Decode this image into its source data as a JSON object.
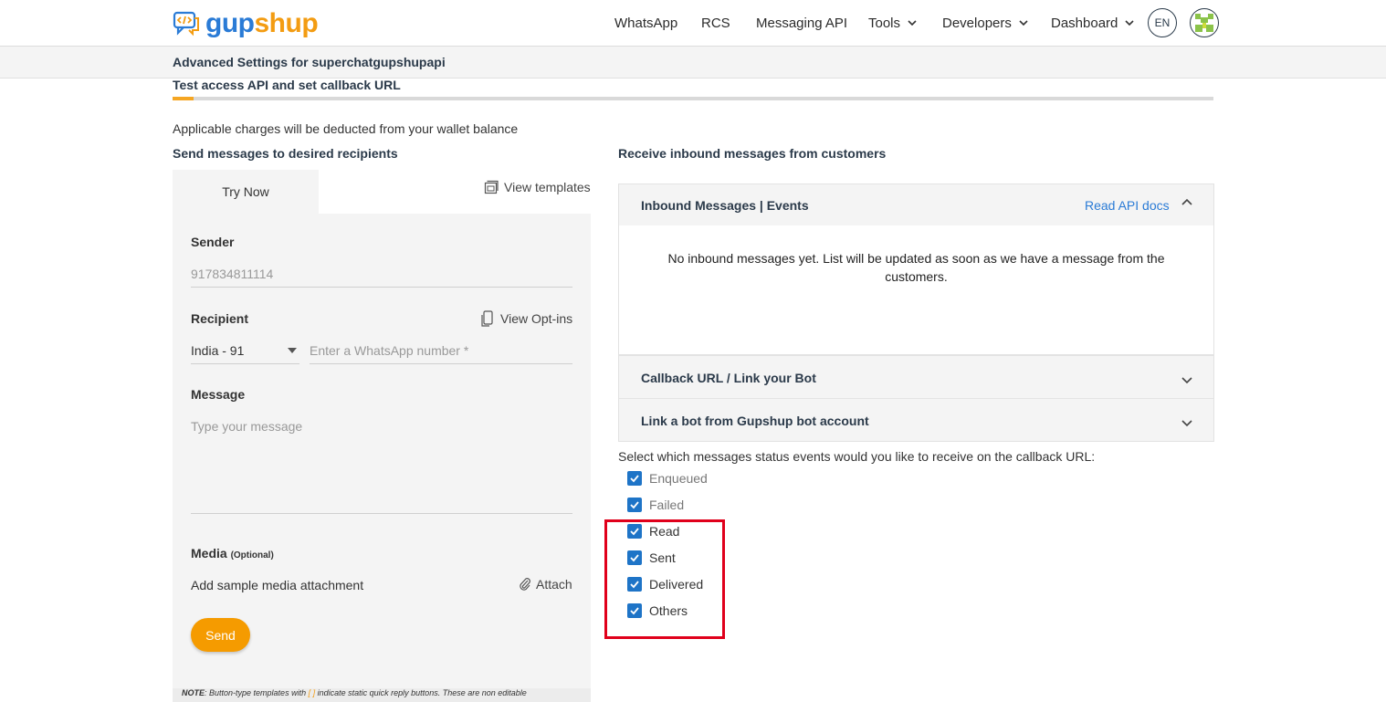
{
  "header": {
    "logo": {
      "part1": "gup",
      "part2": "shup"
    },
    "nav": [
      {
        "label": "WhatsApp",
        "dropdown": false
      },
      {
        "label": "RCS",
        "dropdown": false
      },
      {
        "label": "Messaging API",
        "dropdown": false
      },
      {
        "label": "Tools",
        "dropdown": true
      },
      {
        "label": "Developers",
        "dropdown": true
      },
      {
        "label": "Dashboard",
        "dropdown": true
      }
    ],
    "language": "EN"
  },
  "subheader": {
    "title": "Advanced Settings for superchatgupshupapi"
  },
  "section": {
    "title": "Test access API and set callback URL",
    "progress": 0.02
  },
  "charges_note": "Applicable charges will be deducted from your wallet balance",
  "send": {
    "heading": "Send messages to desired recipients",
    "tab_label": "Try Now",
    "view_templates": "View templates",
    "sender_label": "Sender",
    "sender_value": "917834811114",
    "recipient_label": "Recipient",
    "view_optins": "View Opt-ins",
    "country_value": "India - 91",
    "number_placeholder": "Enter a WhatsApp number *",
    "message_label": "Message",
    "message_placeholder": "Type your message",
    "media_label": "Media",
    "media_optional": "(Optional)",
    "media_text": "Add sample media attachment",
    "attach_label": "Attach",
    "send_label": "Send",
    "note_prefix": "NOTE",
    "note_text": ": Button-type templates with",
    "note_bracket": "[ ]",
    "note_suffix": "indicate static quick reply buttons. These are non editable"
  },
  "receive": {
    "heading": "Receive inbound messages from customers",
    "panels": [
      {
        "title": "Inbound Messages | Events",
        "link": "Read API docs",
        "expanded": true
      },
      {
        "title": "Callback URL / Link your Bot",
        "expanded": false
      },
      {
        "title": "Link a bot from Gupshup bot account",
        "expanded": false
      }
    ],
    "empty_message": "No inbound messages yet. List will be updated as soon as we have a message from the customers.",
    "status_prompt": "Select which messages status events would you like to receive on the callback URL:",
    "statuses": [
      {
        "label": "Enqueued",
        "checked": true,
        "disabled": true
      },
      {
        "label": "Failed",
        "checked": true,
        "disabled": true
      },
      {
        "label": "Read",
        "checked": true,
        "disabled": false
      },
      {
        "label": "Sent",
        "checked": true,
        "disabled": false
      },
      {
        "label": "Delivered",
        "checked": true,
        "disabled": false
      },
      {
        "label": "Others",
        "checked": true,
        "disabled": false
      }
    ]
  },
  "colors": {
    "brand_blue": "#2a7bd6",
    "brand_orange": "#f39c12",
    "send_button": "#f59b00",
    "checkbox": "#1e74c7",
    "highlight_box": "#e0001b"
  }
}
